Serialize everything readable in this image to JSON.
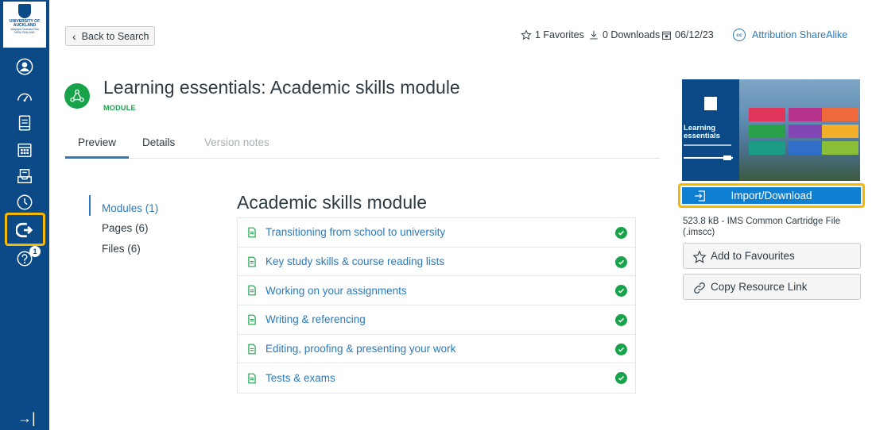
{
  "global_nav": {
    "logo_lines": [
      "UNIVERSITY OF",
      "AUCKLAND"
    ],
    "logo_sub": "Waipapa Taumata Rau",
    "logo_country": "NEW ZEALAND",
    "icons": [
      "account-icon",
      "dashboard-icon",
      "courses-icon",
      "calendar-icon",
      "inbox-icon",
      "history-icon",
      "commons-icon",
      "help-icon"
    ],
    "help_badge": "1",
    "collapse_glyph": "→|"
  },
  "header": {
    "back_label": "Back to Search",
    "favorites": "1 Favorites",
    "downloads": "0 Downloads",
    "date": "06/12/23",
    "license": "Attribution ShareAlike",
    "license_badge": "cc"
  },
  "resource": {
    "title": "Learning essentials: Academic skills module",
    "type": "MODULE"
  },
  "tabs": [
    "Preview",
    "Details",
    "Version notes"
  ],
  "subnav": [
    "Modules (1)",
    "Pages (6)",
    "Files (6)"
  ],
  "module": {
    "heading": "Academic skills module",
    "items": [
      "Transitioning from school to university",
      "Key study skills & course reading lists",
      "Working on your assignments",
      "Writing & referencing",
      "Editing, proofing & presenting your work",
      "Tests & exams"
    ]
  },
  "sidebar": {
    "thumb_title_1": "Learning",
    "thumb_title_2": "essentials",
    "import_label": "Import/Download",
    "file_info": "523.8 kB - IMS Common Cartridge File (.imscc)",
    "favourite_label": "Add to Favourites",
    "copy_label": "Copy Resource Link"
  },
  "colors": {
    "nav_bg": "#0b4a86",
    "highlight": "#f5b800",
    "accent": "#2b7abc",
    "success": "#17a34a",
    "primary_button": "#0e7fd1"
  }
}
